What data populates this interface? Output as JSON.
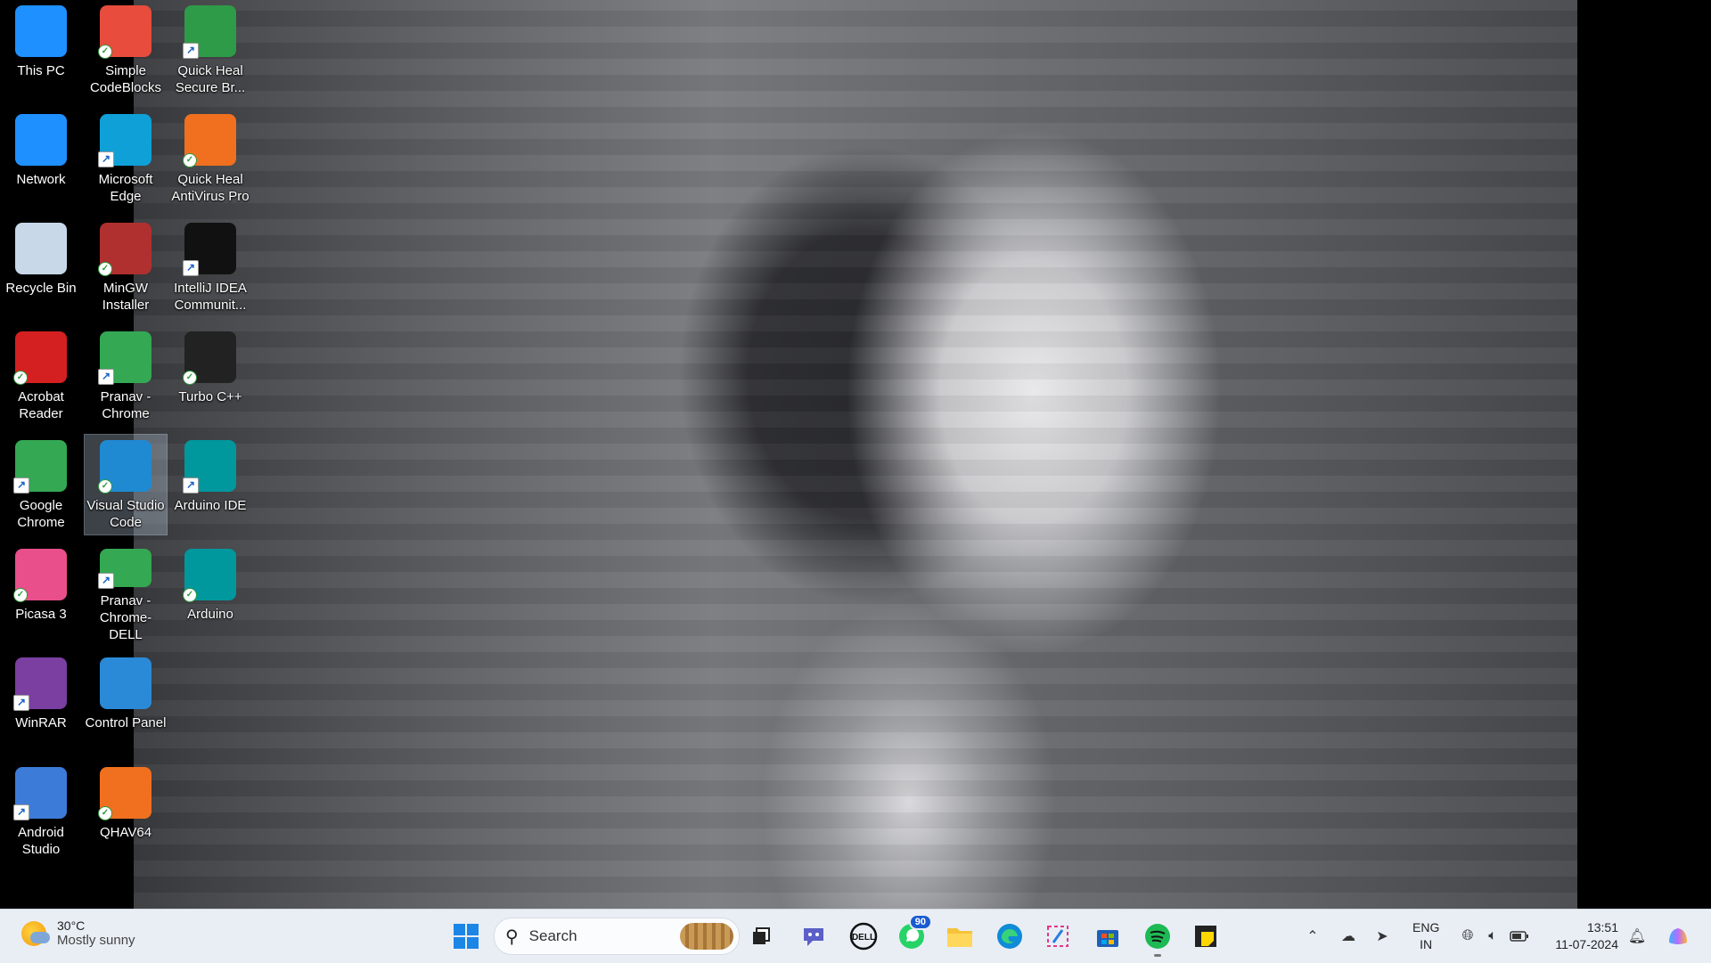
{
  "desktop": {
    "icons": [
      {
        "label": "This PC",
        "icon": "monitor-icon",
        "color": "#1e90ff"
      },
      {
        "label": "Simple\nCodeBlocks",
        "icon": "codeblocks-icon",
        "color": "#e74c3c"
      },
      {
        "label": "Quick Heal\nSecure Br...",
        "icon": "quickheal-browser-icon",
        "color": "#2e9b48"
      },
      {
        "label": "Network",
        "icon": "network-icon",
        "color": "#1e90ff"
      },
      {
        "label": "Microsoft\nEdge",
        "icon": "edge-icon",
        "color": "#0fa0d8"
      },
      {
        "label": "Quick Heal\nAntiVirus Pro",
        "icon": "quickheal-icon",
        "color": "#f07020"
      },
      {
        "label": "Recycle Bin",
        "icon": "recycle-bin-icon",
        "color": "#c8d8e8"
      },
      {
        "label": "MinGW\nInstaller",
        "icon": "mingw-icon",
        "color": "#b03030"
      },
      {
        "label": "IntelliJ IDEA\nCommunit...",
        "icon": "intellij-icon",
        "color": "#111111"
      },
      {
        "label": "Acrobat\nReader",
        "icon": "acrobat-icon",
        "color": "#d42020"
      },
      {
        "label": "Pranav -\nChrome",
        "icon": "chrome-profile-icon",
        "color": "#34a853"
      },
      {
        "label": "Turbo C++",
        "icon": "turbo-cpp-icon",
        "color": "#222222"
      },
      {
        "label": "Google\nChrome",
        "icon": "chrome-icon",
        "color": "#34a853"
      },
      {
        "label": "Visual Studio\nCode",
        "icon": "vscode-icon",
        "color": "#1f8ad2"
      },
      {
        "label": "Arduino IDE",
        "icon": "arduino-ide-icon",
        "color": "#00979d"
      },
      {
        "label": "Picasa 3",
        "icon": "picasa-icon",
        "color": "#e94f8a"
      },
      {
        "label": "Pranav -\nChrome-DELL",
        "icon": "chrome-profile-icon",
        "color": "#34a853"
      },
      {
        "label": "Arduino",
        "icon": "arduino-icon",
        "color": "#00979d"
      },
      {
        "label": "WinRAR",
        "icon": "winrar-icon",
        "color": "#7a3fa0"
      },
      {
        "label": "Control Panel",
        "icon": "control-panel-icon",
        "color": "#2a8ad8"
      },
      {
        "label": "Android\nStudio",
        "icon": "android-studio-icon",
        "color": "#3d7bd9"
      },
      {
        "label": "QHAV64",
        "icon": "qhav64-icon",
        "color": "#f07020"
      }
    ]
  },
  "taskbar": {
    "weather": {
      "temp": "30°C",
      "condition": "Mostly sunny"
    },
    "search_placeholder": "Search",
    "whatsapp_badge": "90",
    "lang_line1": "ENG",
    "lang_line2": "IN",
    "time": "13:51",
    "date": "11-07-2024"
  }
}
